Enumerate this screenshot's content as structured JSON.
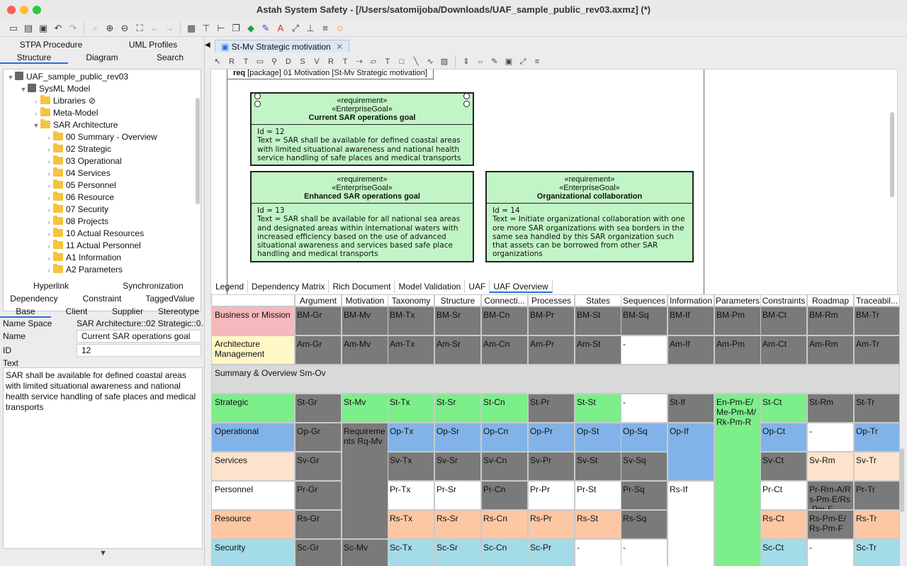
{
  "window": {
    "title": "Astah System Safety - [/Users/satomijoba/Downloads/UAF_sample_public_rev03.axmz] (*)"
  },
  "left_top_tabs": [
    "STPA Procedure",
    "UML Profiles"
  ],
  "left_nav_tabs": [
    "Structure",
    "Diagram",
    "Search"
  ],
  "tree": [
    {
      "label": "UAF_sample_public_rev03",
      "depth": 0
    },
    {
      "label": "SysML Model",
      "depth": 1
    },
    {
      "label": "Libraries",
      "depth": 2,
      "badge": "⊘"
    },
    {
      "label": "Meta-Model",
      "depth": 2
    },
    {
      "label": "SAR Architecture",
      "depth": 2
    },
    {
      "label": "00 Summary - Overview",
      "depth": 3
    },
    {
      "label": "02 Strategic",
      "depth": 3
    },
    {
      "label": "03 Operational",
      "depth": 3
    },
    {
      "label": "04 Services",
      "depth": 3
    },
    {
      "label": "05 Personnel",
      "depth": 3
    },
    {
      "label": "06 Resource",
      "depth": 3
    },
    {
      "label": "07 Security",
      "depth": 3
    },
    {
      "label": "08 Projects",
      "depth": 3
    },
    {
      "label": "10 Actual Resources",
      "depth": 3
    },
    {
      "label": "11 Actual Personnel",
      "depth": 3
    },
    {
      "label": "A1 Information",
      "depth": 3
    },
    {
      "label": "A2 Parameters",
      "depth": 3
    }
  ],
  "prop_tabs_row1": [
    "Hyperlink",
    "Synchronization"
  ],
  "prop_tabs_row2": [
    "Dependency",
    "Constraint",
    "TaggedValue"
  ],
  "prop_tabs_row3": [
    "Base",
    "Client",
    "Supplier",
    "Stereotype"
  ],
  "props": {
    "namespace_label": "Name Space",
    "namespace_value": "SAR Architecture::02 Strategic::0...",
    "name_label": "Name",
    "name_value": "Current SAR operations goal",
    "id_label": "ID",
    "id_value": "12",
    "text_label": "Text",
    "text_value": "SAR shall be available for defined coastal areas with limited situational awareness and national health service handling of safe places and medical transports"
  },
  "diagram": {
    "tab": "St-Mv Strategic motivation",
    "frame_kw": "req",
    "frame_label": " [package] 01 Motivation [St-Mv Strategic motivation]",
    "reqs": [
      {
        "st1": "«requirement»",
        "st2": "«EnterpriseGoal»",
        "name": "Current SAR operations goal",
        "id": "Id = 12",
        "text": "Text = SAR shall be available for defined coastal areas with limited situational awareness and national health service handling of safe places and medical transports"
      },
      {
        "st1": "«requirement»",
        "st2": "«EnterpriseGoal»",
        "name": "Enhanced SAR operations goal",
        "id": "Id = 13",
        "text": "Text = SAR shall be available for all national sea areas and designated areas within international waters with increased efficiency based on the use of advanced situational awareness and services based safe place handling and medical transports"
      },
      {
        "st1": "«requirement»",
        "st2": "«EnterpriseGoal»",
        "name": "Organizational collaboration",
        "id": "Id = 14",
        "text": "Text = Initiate organizational collaboration with one ore more SAR organizations with sea borders in the same sea handled by this SAR organization such that assets can be borrowed from other SAR organizations"
      }
    ]
  },
  "bottom_tabs": [
    "Legend",
    "Dependency Matrix",
    "Rich Document",
    "Model Validation",
    "UAF",
    "UAF Overview"
  ],
  "uaf": {
    "columns": [
      "Argument",
      "Motivation",
      "Taxonomy",
      "Structure",
      "Connecti...",
      "Processes",
      "States",
      "Sequences",
      "Information",
      "Parameters",
      "Constraints",
      "Roadmap",
      "Traceabil..."
    ],
    "rows": [
      {
        "label": "Business or Mission",
        "color": "#f7b8bc"
      },
      {
        "label": "Architecture Management",
        "color": "#fff7c6"
      },
      {
        "label": "Summary & Overview Sm-Ov",
        "color": "#d9d9d9"
      },
      {
        "label": "Strategic",
        "color": "#7cee8a"
      },
      {
        "label": "Operational",
        "color": "#82b3e8"
      },
      {
        "label": "Services",
        "color": "#fde3cb"
      },
      {
        "label": "Personnel",
        "color": "#ffffff"
      },
      {
        "label": "Resource",
        "color": "#fdc7a3"
      },
      {
        "label": "Security",
        "color": "#a3dbe8"
      }
    ],
    "cells": [
      [
        "BM-Gr",
        "BM-Mv",
        "BM-Tx",
        "BM-Sr",
        "BM-Cn",
        "BM-Pr",
        "BM-St",
        "BM-Sq",
        "BM-If",
        "BM-Pm",
        "BM-Ct",
        "BM-Rm",
        "BM-Tr"
      ],
      [
        "Am-Gr",
        "Am-Mv",
        "Am-Tx",
        "Am-Sr",
        "Am-Cn",
        "Am-Pr",
        "Am-St",
        "-",
        "Am-If",
        "Am-Pm",
        "Am-Ct",
        "Am-Rm",
        "Am-Tr"
      ],
      [],
      [
        "St-Gr",
        "St-Mv",
        "St-Tx",
        "St-Sr",
        "St-Cn",
        "St-Pr",
        "St-St",
        "-",
        "St-If",
        "En-Pm-E/Me-Pm-M/Rk-Pm-R",
        "St-Ct",
        "St-Rm",
        "St-Tr"
      ],
      [
        "Op-Gr",
        "Requirements Rq-Mv",
        "Op-Tx",
        "Op-Sr",
        "Op-Cn",
        "Op-Pr",
        "Op-St",
        "Op-Sq",
        "Op-If",
        "",
        "Op-Ct",
        "-",
        "Op-Tr"
      ],
      [
        "Sv-Gr",
        "",
        "Sv-Tx",
        "Sv-Sr",
        "Sv-Cn",
        "Sv-Pr",
        "Sv-St",
        "Sv-Sq",
        "",
        "",
        "Sv-Ct",
        "Sv-Rm",
        "Sv-Tr"
      ],
      [
        "Pr-Gr",
        "",
        "Pr-Tx",
        "Pr-Sr",
        "Pr-Cn",
        "Pr-Pr",
        "Pr-St",
        "Pr-Sq",
        "Rs-If",
        "",
        "Pr-Ct",
        "Pr-Rm-A/Rs-Pm-E/Rs-Pm-F",
        "Pr-Tr"
      ],
      [
        "Rs-Gr",
        "",
        "Rs-Tx",
        "Rs-Sr",
        "Rs-Cn",
        "Rs-Pr",
        "Rs-St",
        "Rs-Sq",
        "",
        "",
        "Rs-Ct",
        "Rs-Pm-E/Rs-Pm-F",
        "Rs-Tr"
      ],
      [
        "Sc-Gr",
        "Sc-Mv",
        "Sc-Tx",
        "Sc-Sr",
        "Sc-Cn",
        "Sc-Pr",
        "-",
        "-",
        "",
        "",
        "Sc-Ct",
        "-",
        "Sc-Tr"
      ]
    ]
  }
}
